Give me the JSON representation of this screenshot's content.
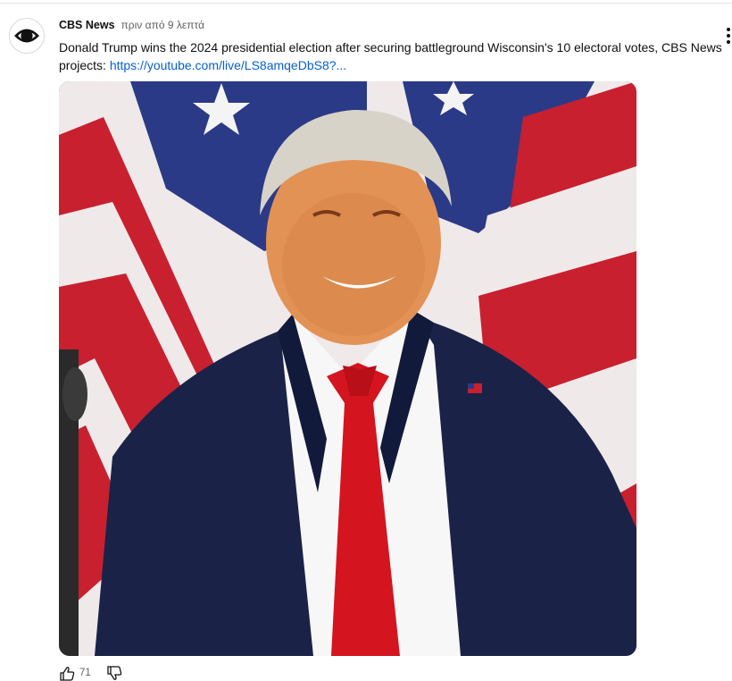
{
  "post": {
    "channel_name": "CBS News",
    "time_ago": "πριν από 9 λεπτά",
    "text": "Donald Trump wins the 2024 presidential election after securing battleground Wisconsin's 10 electoral votes, CBS News projects: ",
    "link_text": "https://youtube.com/live/LS8amqeDbS8?...",
    "avatar_icon": "cbs-eye-logo",
    "more_icon": "vertical-ellipsis-icon",
    "image_description_icon": "photo"
  },
  "actions": {
    "like_icon": "thumbs-up-icon",
    "like_count": "71",
    "dislike_icon": "thumbs-down-icon"
  },
  "colors": {
    "link": "#065fd4",
    "text": "#0f0f0f",
    "secondary_text": "#606060",
    "flag_red": "#c8202f",
    "flag_blue": "#2b3a86",
    "suit": "#1a2347",
    "tie": "#d4141f"
  }
}
